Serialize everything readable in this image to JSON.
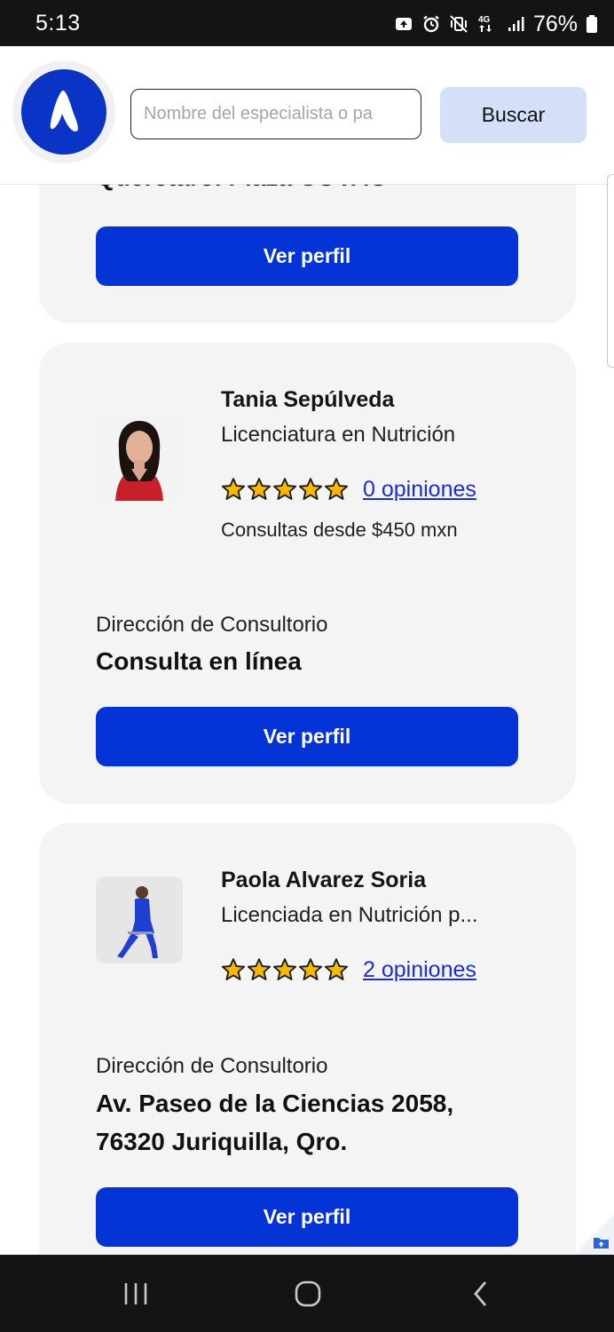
{
  "status_bar": {
    "time": "5:13",
    "network": "4G",
    "battery_percent": "76%",
    "icons": [
      "photo-notification-icon",
      "alarm-icon",
      "vibrate-icon",
      "network-4g-icon",
      "signal-icon",
      "battery-icon"
    ]
  },
  "header": {
    "logo": "brand-logo-icon",
    "search": {
      "placeholder": "Nombre del especialista o pa",
      "value": ""
    },
    "search_button": "Buscar"
  },
  "partial_card": {
    "address_partial": "Querétaro. Plaza COVAO",
    "button": "Ver perfil"
  },
  "specialists": [
    {
      "name": "Tania Sepúlveda",
      "specialty": "Licenciatura en Nutrición",
      "rating_stars": 5,
      "reviews": "0 opiniones",
      "price": "Consultas desde $450 mxn",
      "address_label": "Dirección de Consultorio",
      "address": "Consulta en línea",
      "button": "Ver perfil"
    },
    {
      "name": "Paola Alvarez Soria",
      "specialty": "Licenciada en Nutrición p...",
      "rating_stars": 5,
      "reviews": "2 opiniones",
      "price": "",
      "address_label": "Dirección de Consultorio",
      "address": "Av. Paseo de la Ciencias 2058, 76320 Juriquilla, Qro.",
      "button": "Ver perfil"
    }
  ],
  "nav_bar": {
    "icons": [
      "recent-apps-icon",
      "home-icon",
      "back-icon"
    ]
  },
  "colors": {
    "primary_button": "#0433d6",
    "logo_bg": "#0934c6",
    "search_button_bg": "#d3e0f8",
    "card_bg": "#f4f4f5",
    "star": "#f9b800",
    "link": "#1b2ed0"
  }
}
